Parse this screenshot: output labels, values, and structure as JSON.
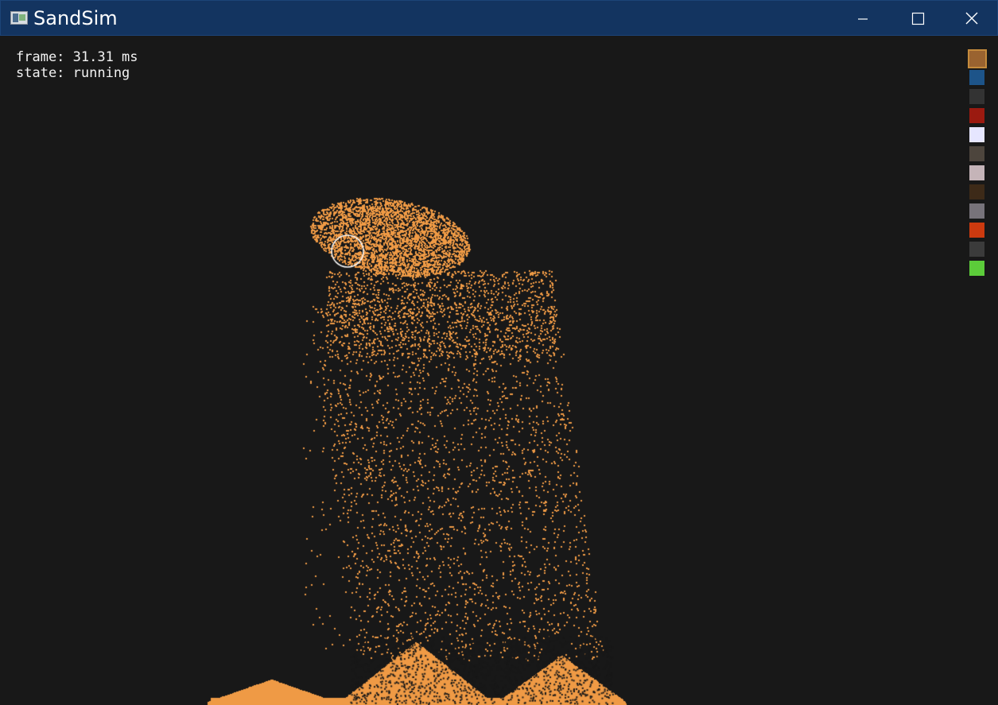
{
  "window": {
    "title": "SandSim"
  },
  "hud": {
    "frame": "frame: 31.31 ms",
    "state": "state: running"
  },
  "palette": {
    "selected_index": 0,
    "colors": [
      "#9a6330",
      "#1d5489",
      "#333333",
      "#9b1a10",
      "#e6e6ff",
      "#4d453d",
      "#c5b4b8",
      "#3d2a18",
      "#77737a",
      "#cc3a0f",
      "#3b3b3b",
      "#5ccc3a"
    ]
  },
  "simulation": {
    "background": "#181818",
    "particle_color": "#ef9a45",
    "cursor_color": "#ffffff"
  }
}
